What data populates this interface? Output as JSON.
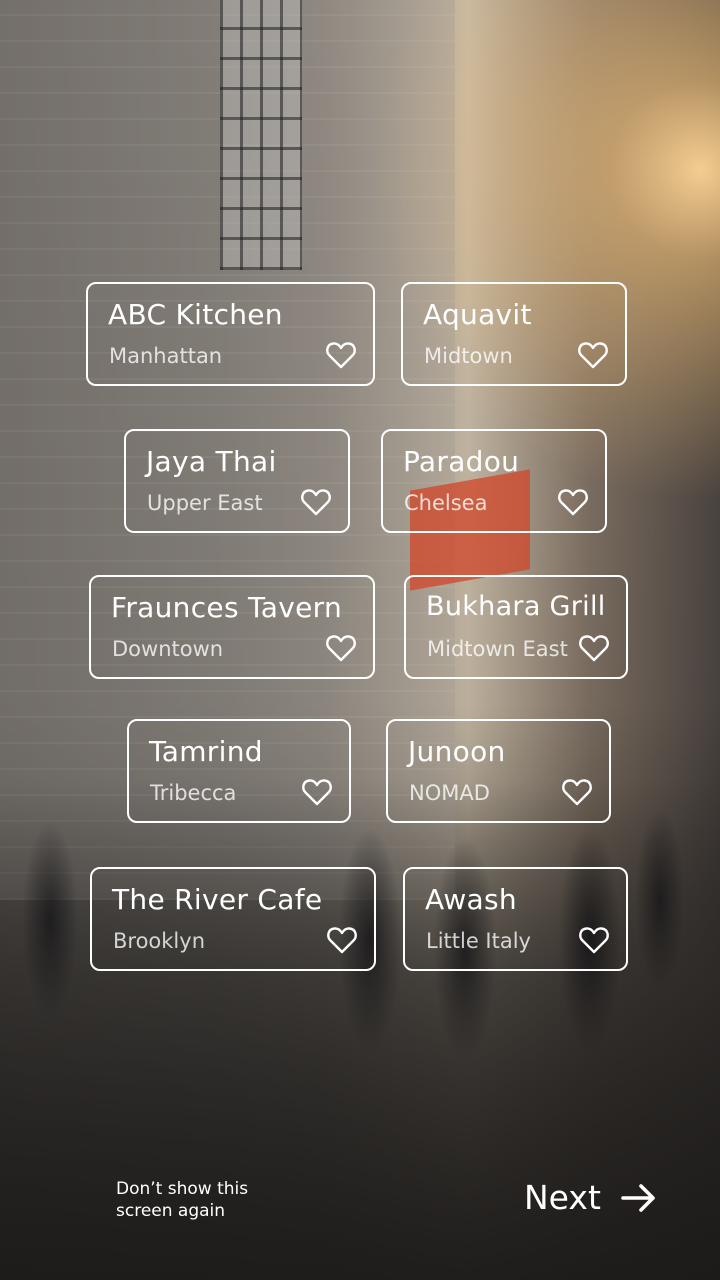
{
  "restaurants": [
    {
      "name": "ABC  Kitchen",
      "area": "Manhattan"
    },
    {
      "name": "Aquavit",
      "area": "Midtown"
    },
    {
      "name": "Jaya Thai",
      "area": "Upper East"
    },
    {
      "name": "Paradou",
      "area": "Chelsea"
    },
    {
      "name": "Fraunces Tavern",
      "area": "Downtown"
    },
    {
      "name": "Bukhara Grill",
      "area": "Midtown East"
    },
    {
      "name": "Tamrind",
      "area": "Tribecca"
    },
    {
      "name": "Junoon",
      "area": "NOMAD"
    },
    {
      "name": "The River Cafe",
      "area": "Brooklyn"
    },
    {
      "name": "Awash",
      "area": "Little Italy"
    }
  ],
  "footer": {
    "dont_show_line1": "Don’t show this",
    "dont_show_line2": "screen again",
    "next_label": "Next"
  },
  "icons": {
    "favorite": "heart-outline-icon",
    "next": "arrow-right-icon"
  },
  "colors": {
    "text": "#ffffff",
    "border": "#ffffff"
  }
}
